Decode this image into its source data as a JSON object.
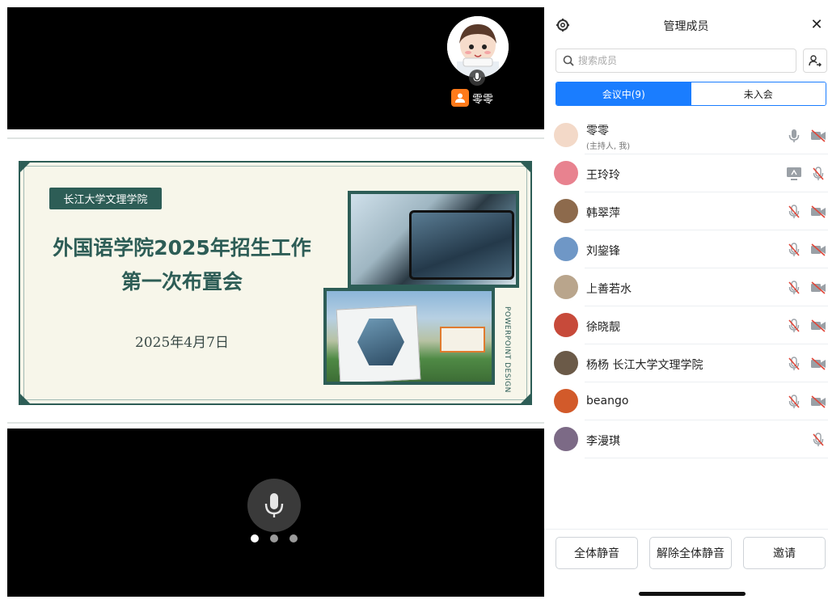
{
  "video": {
    "speaker_name": "零零",
    "slide": {
      "school_tag": "长江大学文理学院",
      "title_line1": "外国语学院2025年招生工作",
      "title_line2": "第一次布置会",
      "date": "2025年4月7日",
      "side_text": "POWERPOINT DESIGN"
    },
    "page_dots": 3,
    "active_dot": 0
  },
  "panel": {
    "title": "管理成员",
    "search_placeholder": "搜索成员",
    "tabs": [
      {
        "label": "会议中(9)",
        "active": true
      },
      {
        "label": "未入会",
        "active": false
      }
    ],
    "members": [
      {
        "name": "零零",
        "sub": "(主持人, 我)",
        "avatar_color": "#f3d9c8",
        "icons": [
          "mic-on-icon",
          "camera-off-icon"
        ]
      },
      {
        "name": "王玲玲",
        "sub": "",
        "avatar_color": "#e8828f",
        "icons": [
          "screen-share-icon",
          "mic-off-icon"
        ]
      },
      {
        "name": "韩翠萍",
        "sub": "",
        "avatar_color": "#8d6a4c",
        "icons": [
          "mic-off-icon",
          "camera-off-icon"
        ]
      },
      {
        "name": "刘鋆锋",
        "sub": "",
        "avatar_color": "#6f97c6",
        "icons": [
          "mic-off-icon",
          "camera-off-icon"
        ]
      },
      {
        "name": "上善若水",
        "sub": "",
        "avatar_color": "#b9a58c",
        "icons": [
          "mic-off-icon",
          "camera-off-icon"
        ]
      },
      {
        "name": "徐晓靓",
        "sub": "",
        "avatar_color": "#c74a3a",
        "icons": [
          "mic-off-icon",
          "camera-off-icon"
        ]
      },
      {
        "name": "杨杨 长江大学文理学院",
        "sub": "",
        "avatar_color": "#6b5a48",
        "icons": [
          "mic-off-icon",
          "camera-off-icon"
        ]
      },
      {
        "name": "beango",
        "sub": "",
        "avatar_color": "#d25a2a",
        "icons": [
          "mic-off-icon",
          "camera-off-icon"
        ]
      },
      {
        "name": "李漫琪",
        "sub": "",
        "avatar_color": "#7c6a86",
        "icons": [
          "mic-off-icon"
        ]
      }
    ],
    "footer": {
      "mute_all": "全体静音",
      "unmute_all": "解除全体静音",
      "invite": "邀请"
    }
  },
  "colors": {
    "accent": "#1a7dff",
    "slide_green": "#2d5d56",
    "muted_red": "#e0473a",
    "speaker_badge": "#ff7a1a"
  }
}
